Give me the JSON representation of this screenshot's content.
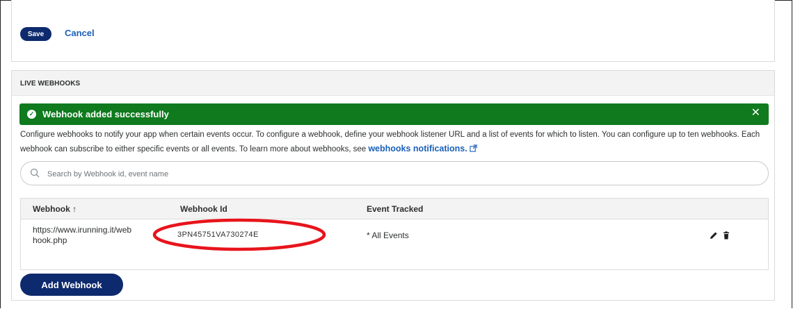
{
  "form": {
    "save_label": "Save",
    "cancel_label": "Cancel"
  },
  "live_webhooks": {
    "title": "LIVE WEBHOOKS",
    "alert": {
      "message": "Webhook added successfully",
      "close_symbol": "✕"
    },
    "description_part1": "Configure webhooks to notify your app when certain events occur. To configure a webhook, define your webhook listener URL and a list of events for which to listen. You can configure up to ten webhooks. Each webhook can subscribe to either specific events or all events. To learn more about webhooks, see ",
    "description_link": "webhooks notifications.",
    "search": {
      "placeholder": "Search by Webhook id, event name"
    },
    "table": {
      "columns": [
        "Webhook ↑",
        "Webhook Id",
        "Event Tracked"
      ],
      "rows": [
        {
          "url": "https://www.irunning.it/webhook.php",
          "url_line1": "https://www.irunning.it/web",
          "url_line2": "hook.php",
          "webhook_id": "3PN45751VA730274E",
          "event": "* All Events"
        }
      ]
    },
    "add_button_label": "Add Webhook"
  },
  "colors": {
    "primary_button": "#0e2a6e",
    "link": "#1b5fb8",
    "success": "#0f7a1e",
    "annotation": "#e8141c"
  },
  "icons": {
    "alert": "check-circle-icon",
    "close": "close-icon",
    "search": "search-icon",
    "external": "external-link-icon",
    "edit": "pencil-icon",
    "delete": "trash-icon"
  }
}
